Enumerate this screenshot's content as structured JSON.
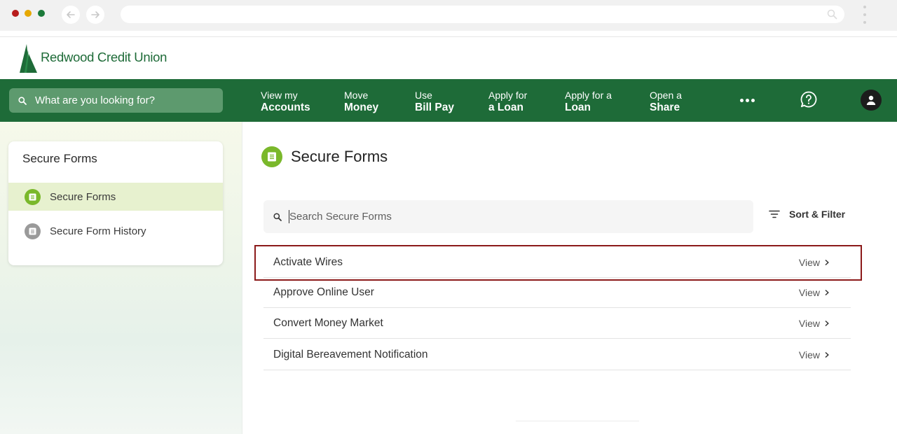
{
  "browser": {
    "window_controls": [
      "close",
      "minimize",
      "maximize"
    ],
    "nav_icons": [
      "back-arrow-icon",
      "forward-arrow-icon"
    ],
    "address_bar_value": "",
    "search_icon": "search-icon"
  },
  "brand": {
    "name": "Redwood Credit Union",
    "color": "#1e6b38"
  },
  "nav": {
    "search_placeholder": "What are you looking for?",
    "items": [
      {
        "line1": "View my",
        "line2": "Accounts"
      },
      {
        "line1": "Move",
        "line2": "Money"
      },
      {
        "line1": "Use",
        "line2": "Bill Pay"
      },
      {
        "line1": "Apply for",
        "line2": "a Loan"
      },
      {
        "line1": "Apply for a",
        "line2": "Loan"
      },
      {
        "line1": "Open a",
        "line2": "Share"
      }
    ],
    "more_icon": "more-dots-icon",
    "help_icon": "help-chat-icon",
    "profile_icon": "profile-icon"
  },
  "sidebar": {
    "title": "Secure Forms",
    "items": [
      {
        "label": "Secure Forms",
        "active": true,
        "icon": "document-icon"
      },
      {
        "label": "Secure Form History",
        "active": false,
        "icon": "document-icon"
      }
    ]
  },
  "main": {
    "heading": "Secure Forms",
    "search_placeholder": "Search Secure Forms",
    "sort_filter_label": "Sort & Filter",
    "forms": [
      {
        "name": "Activate Wires",
        "action": "View",
        "highlighted": true
      },
      {
        "name": "Approve Online User",
        "action": "View",
        "highlighted": false
      },
      {
        "name": "Convert Money Market",
        "action": "View",
        "highlighted": false
      },
      {
        "name": "Digital Bereavement Notification",
        "action": "View",
        "highlighted": false
      }
    ]
  },
  "colors": {
    "nav_green": "#1e6b38",
    "accent_lime": "#7ab82b",
    "highlight_border": "#8b1a1a",
    "active_item_bg": "#e7f1cf"
  }
}
